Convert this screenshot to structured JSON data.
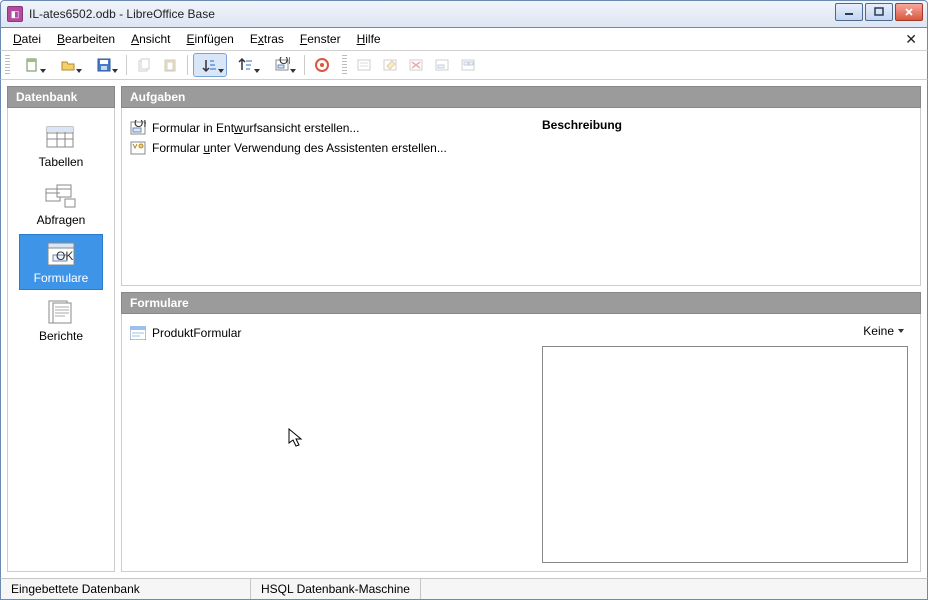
{
  "window": {
    "title": "IL-ates6502.odb - LibreOffice Base"
  },
  "menu": {
    "datei": "Datei",
    "bearbeiten": "Bearbeiten",
    "ansicht": "Ansicht",
    "einfuegen": "Einfügen",
    "extras": "Extras",
    "fenster": "Fenster",
    "hilfe": "Hilfe"
  },
  "sidebar": {
    "header": "Datenbank",
    "items": [
      {
        "label": "Tabellen"
      },
      {
        "label": "Abfragen"
      },
      {
        "label": "Formulare"
      },
      {
        "label": "Berichte"
      }
    ]
  },
  "tasks": {
    "header": "Aufgaben",
    "items": [
      {
        "label": "Formular in Entwurfsansicht erstellen..."
      },
      {
        "label": "Formular unter Verwendung des Assistenten erstellen..."
      }
    ],
    "descTitle": "Beschreibung"
  },
  "forms": {
    "header": "Formulare",
    "items": [
      {
        "label": "ProduktFormular"
      }
    ],
    "viewMode": "Keine"
  },
  "status": {
    "left": "Eingebettete Datenbank",
    "mid": "HSQL Datenbank-Maschine"
  }
}
